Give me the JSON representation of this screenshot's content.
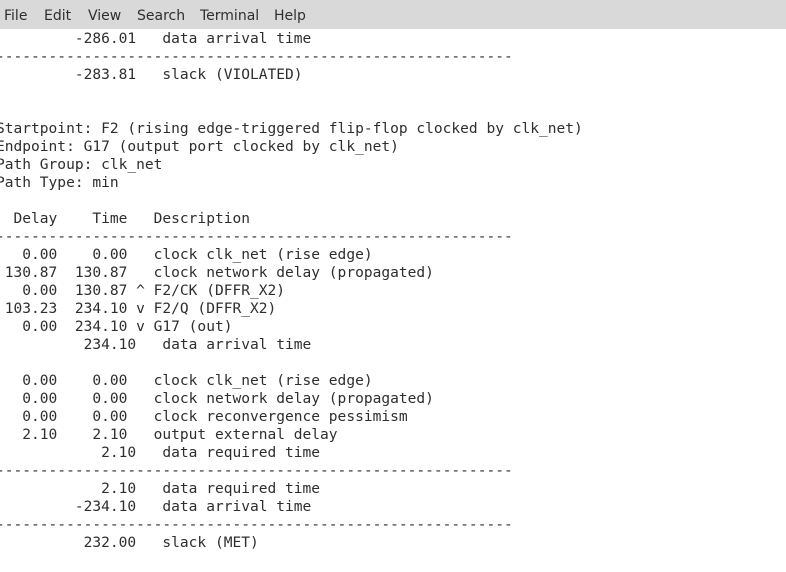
{
  "menubar": {
    "items": [
      "File",
      "Edit",
      "View",
      "Search",
      "Terminal",
      "Help"
    ]
  },
  "terminal": {
    "lines": [
      "         -286.01   data arrival time",
      "-----------------------------------------------------------",
      "         -283.81   slack (VIOLATED)",
      "",
      "",
      "Startpoint: F2 (rising edge-triggered flip-flop clocked by clk_net)",
      "Endpoint: G17 (output port clocked by clk_net)",
      "Path Group: clk_net",
      "Path Type: min",
      "",
      "  Delay    Time   Description",
      "-----------------------------------------------------------",
      "   0.00    0.00   clock clk_net (rise edge)",
      " 130.87  130.87   clock network delay (propagated)",
      "   0.00  130.87 ^ F2/CK (DFFR_X2)",
      " 103.23  234.10 v F2/Q (DFFR_X2)",
      "   0.00  234.10 v G17 (out)",
      "          234.10   data arrival time",
      "",
      "   0.00    0.00   clock clk_net (rise edge)",
      "   0.00    0.00   clock network delay (propagated)",
      "   0.00    0.00   clock reconvergence pessimism",
      "   2.10    2.10   output external delay",
      "            2.10   data required time",
      "-----------------------------------------------------------",
      "            2.10   data required time",
      "         -234.10   data arrival time",
      "-----------------------------------------------------------",
      "          232.00   slack (MET)"
    ]
  }
}
